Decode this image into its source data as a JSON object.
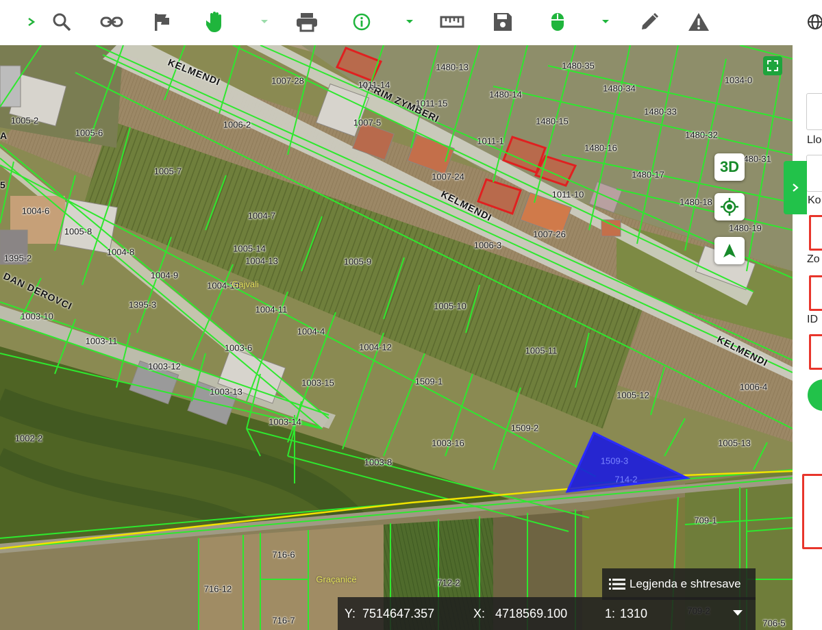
{
  "toolbar": {
    "items": [
      "expand-arrow",
      "search",
      "link",
      "flag",
      "pan-hand",
      "dropdown-faint",
      "print",
      "info",
      "dropdown",
      "ruler",
      "save",
      "mouse",
      "dropdown",
      "pencil",
      "warning",
      "globe"
    ]
  },
  "map": {
    "parcel_labels": [
      {
        "t": "1007-28"
      },
      {
        "t": "1011-14"
      },
      {
        "t": "1011-15"
      },
      {
        "t": "1007-5"
      },
      {
        "t": "1480-13"
      },
      {
        "t": "1480-35"
      },
      {
        "t": "1480-14"
      },
      {
        "t": "1480-34"
      },
      {
        "t": "1480-15"
      },
      {
        "t": "1480-33"
      },
      {
        "t": "1480-32"
      },
      {
        "t": "1034-0"
      },
      {
        "t": "1011-1"
      },
      {
        "t": "1480-16"
      },
      {
        "t": "1480-17"
      },
      {
        "t": "1480-18"
      },
      {
        "t": "1480-19"
      },
      {
        "t": "1480-31"
      },
      {
        "t": "1005-2"
      },
      {
        "t": "1005-6"
      },
      {
        "t": "1006-2"
      },
      {
        "t": "1005-7"
      },
      {
        "t": "1007-24"
      },
      {
        "t": "1011-10"
      },
      {
        "t": "1004-6"
      },
      {
        "t": "1005-8"
      },
      {
        "t": "1004-7"
      },
      {
        "t": "1007-26"
      },
      {
        "t": "1006-3"
      },
      {
        "t": "1005-14"
      },
      {
        "t": "1004-13"
      },
      {
        "t": "1395-2"
      },
      {
        "t": "1004-8"
      },
      {
        "t": "1005-9"
      },
      {
        "t": "1004-9"
      },
      {
        "t": "1004-10"
      },
      {
        "t": "1395-3"
      },
      {
        "t": "1004-11"
      },
      {
        "t": "1005-10"
      },
      {
        "t": "1003-10"
      },
      {
        "t": "1004-4"
      },
      {
        "t": "1003-11"
      },
      {
        "t": "1003-6"
      },
      {
        "t": "1004-12"
      },
      {
        "t": "1005-11"
      },
      {
        "t": "1003-12"
      },
      {
        "t": "1003-15"
      },
      {
        "t": "1509-1"
      },
      {
        "t": "1005-12"
      },
      {
        "t": "1006-4"
      },
      {
        "t": "1003-13"
      },
      {
        "t": "1003-14"
      },
      {
        "t": "1509-2"
      },
      {
        "t": "1002-2"
      },
      {
        "t": "1003-16"
      },
      {
        "t": "1005-13"
      },
      {
        "t": "1003-8"
      },
      {
        "t": "1509-3"
      },
      {
        "t": "714-2"
      },
      {
        "t": "709-1"
      },
      {
        "t": "716-6"
      },
      {
        "t": "712-2"
      },
      {
        "t": "716-12"
      },
      {
        "t": "716-7"
      },
      {
        "t": "709-2"
      },
      {
        "t": "706-5"
      }
    ],
    "street_labels": [
      {
        "t": "KELMENDI"
      },
      {
        "t": "AFRIM ZYMBERI"
      },
      {
        "t": "KELMENDI"
      },
      {
        "t": "KELMENDI"
      },
      {
        "t": "DAN DEROVCI"
      },
      {
        "t": "A"
      },
      {
        "t": "5"
      }
    ],
    "place_labels": [
      "Gajvali",
      "Graçanicë"
    ],
    "selected_parcel": "1509-3",
    "colors": {
      "parcel_line": "#2ee82e",
      "selected_fill": "#1414e6",
      "building_outline": "#e02020",
      "road_line": "#f2e200",
      "accent": "#22c24a"
    }
  },
  "controls": {
    "btn_3d": "3D",
    "legend_label": "Legjenda e shtresave",
    "coords": {
      "y_label": "Y:",
      "y_value": "7514647.357",
      "x_label": "X:",
      "x_value": "4718569.100",
      "scale_label": "1:",
      "scale_value": "1310"
    }
  },
  "panel": {
    "labels": [
      "Llo",
      "Ko",
      "Zo",
      "ID"
    ]
  }
}
